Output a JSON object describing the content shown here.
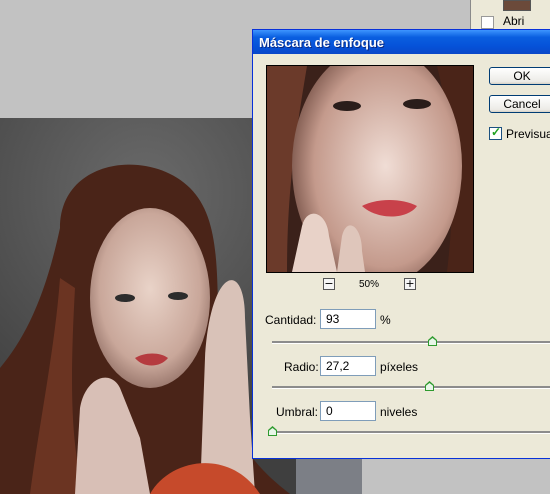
{
  "dialog": {
    "title": "Máscara de enfoque",
    "ok_label": "OK",
    "cancel_label": "Cancel",
    "preview_label": "Previsualizar",
    "preview_checked": true,
    "zoom_out_icon": "minus-icon",
    "zoom_in_icon": "plus-icon",
    "zoom_level": "50%",
    "amount": {
      "label": "Cantidad:",
      "value": "93",
      "unit": "%",
      "slider_fraction": 0.55
    },
    "radius": {
      "label": "Radio:",
      "value": "27,2",
      "unit": "píxeles",
      "slider_fraction": 0.54
    },
    "threshold": {
      "label": "Umbral:",
      "value": "0",
      "unit": "niveles",
      "slider_fraction": 0.0
    }
  },
  "layers_panel": {
    "item_label": "Abri",
    "thumbnail_icon": "layer-thumbnail-icon"
  },
  "colors": {
    "titlebar": "#0a5fe0",
    "dialog_bg": "#ece9d8",
    "slider_thumb": "#2e9a2e",
    "check_mark": "#21a121"
  }
}
